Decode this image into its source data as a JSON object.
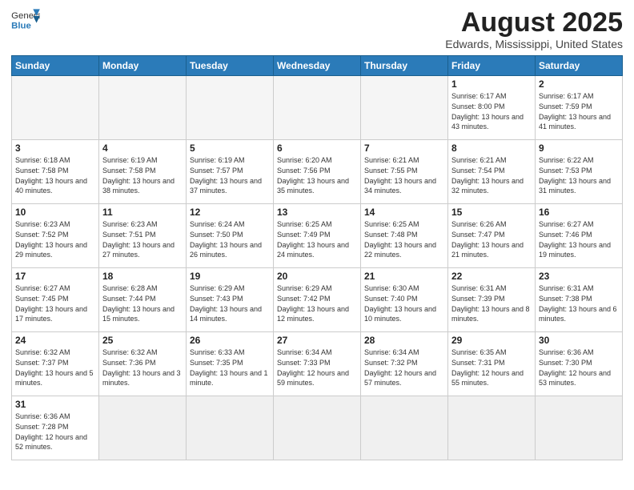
{
  "header": {
    "logo_text_normal": "General",
    "logo_text_blue": "Blue",
    "title": "August 2025",
    "subtitle": "Edwards, Mississippi, United States"
  },
  "weekdays": [
    "Sunday",
    "Monday",
    "Tuesday",
    "Wednesday",
    "Thursday",
    "Friday",
    "Saturday"
  ],
  "weeks": [
    [
      {
        "num": "",
        "info": ""
      },
      {
        "num": "",
        "info": ""
      },
      {
        "num": "",
        "info": ""
      },
      {
        "num": "",
        "info": ""
      },
      {
        "num": "",
        "info": ""
      },
      {
        "num": "1",
        "info": "Sunrise: 6:17 AM\nSunset: 8:00 PM\nDaylight: 13 hours and 43 minutes."
      },
      {
        "num": "2",
        "info": "Sunrise: 6:17 AM\nSunset: 7:59 PM\nDaylight: 13 hours and 41 minutes."
      }
    ],
    [
      {
        "num": "3",
        "info": "Sunrise: 6:18 AM\nSunset: 7:58 PM\nDaylight: 13 hours and 40 minutes."
      },
      {
        "num": "4",
        "info": "Sunrise: 6:19 AM\nSunset: 7:58 PM\nDaylight: 13 hours and 38 minutes."
      },
      {
        "num": "5",
        "info": "Sunrise: 6:19 AM\nSunset: 7:57 PM\nDaylight: 13 hours and 37 minutes."
      },
      {
        "num": "6",
        "info": "Sunrise: 6:20 AM\nSunset: 7:56 PM\nDaylight: 13 hours and 35 minutes."
      },
      {
        "num": "7",
        "info": "Sunrise: 6:21 AM\nSunset: 7:55 PM\nDaylight: 13 hours and 34 minutes."
      },
      {
        "num": "8",
        "info": "Sunrise: 6:21 AM\nSunset: 7:54 PM\nDaylight: 13 hours and 32 minutes."
      },
      {
        "num": "9",
        "info": "Sunrise: 6:22 AM\nSunset: 7:53 PM\nDaylight: 13 hours and 31 minutes."
      }
    ],
    [
      {
        "num": "10",
        "info": "Sunrise: 6:23 AM\nSunset: 7:52 PM\nDaylight: 13 hours and 29 minutes."
      },
      {
        "num": "11",
        "info": "Sunrise: 6:23 AM\nSunset: 7:51 PM\nDaylight: 13 hours and 27 minutes."
      },
      {
        "num": "12",
        "info": "Sunrise: 6:24 AM\nSunset: 7:50 PM\nDaylight: 13 hours and 26 minutes."
      },
      {
        "num": "13",
        "info": "Sunrise: 6:25 AM\nSunset: 7:49 PM\nDaylight: 13 hours and 24 minutes."
      },
      {
        "num": "14",
        "info": "Sunrise: 6:25 AM\nSunset: 7:48 PM\nDaylight: 13 hours and 22 minutes."
      },
      {
        "num": "15",
        "info": "Sunrise: 6:26 AM\nSunset: 7:47 PM\nDaylight: 13 hours and 21 minutes."
      },
      {
        "num": "16",
        "info": "Sunrise: 6:27 AM\nSunset: 7:46 PM\nDaylight: 13 hours and 19 minutes."
      }
    ],
    [
      {
        "num": "17",
        "info": "Sunrise: 6:27 AM\nSunset: 7:45 PM\nDaylight: 13 hours and 17 minutes."
      },
      {
        "num": "18",
        "info": "Sunrise: 6:28 AM\nSunset: 7:44 PM\nDaylight: 13 hours and 15 minutes."
      },
      {
        "num": "19",
        "info": "Sunrise: 6:29 AM\nSunset: 7:43 PM\nDaylight: 13 hours and 14 minutes."
      },
      {
        "num": "20",
        "info": "Sunrise: 6:29 AM\nSunset: 7:42 PM\nDaylight: 13 hours and 12 minutes."
      },
      {
        "num": "21",
        "info": "Sunrise: 6:30 AM\nSunset: 7:40 PM\nDaylight: 13 hours and 10 minutes."
      },
      {
        "num": "22",
        "info": "Sunrise: 6:31 AM\nSunset: 7:39 PM\nDaylight: 13 hours and 8 minutes."
      },
      {
        "num": "23",
        "info": "Sunrise: 6:31 AM\nSunset: 7:38 PM\nDaylight: 13 hours and 6 minutes."
      }
    ],
    [
      {
        "num": "24",
        "info": "Sunrise: 6:32 AM\nSunset: 7:37 PM\nDaylight: 13 hours and 5 minutes."
      },
      {
        "num": "25",
        "info": "Sunrise: 6:32 AM\nSunset: 7:36 PM\nDaylight: 13 hours and 3 minutes."
      },
      {
        "num": "26",
        "info": "Sunrise: 6:33 AM\nSunset: 7:35 PM\nDaylight: 13 hours and 1 minute."
      },
      {
        "num": "27",
        "info": "Sunrise: 6:34 AM\nSunset: 7:33 PM\nDaylight: 12 hours and 59 minutes."
      },
      {
        "num": "28",
        "info": "Sunrise: 6:34 AM\nSunset: 7:32 PM\nDaylight: 12 hours and 57 minutes."
      },
      {
        "num": "29",
        "info": "Sunrise: 6:35 AM\nSunset: 7:31 PM\nDaylight: 12 hours and 55 minutes."
      },
      {
        "num": "30",
        "info": "Sunrise: 6:36 AM\nSunset: 7:30 PM\nDaylight: 12 hours and 53 minutes."
      }
    ],
    [
      {
        "num": "31",
        "info": "Sunrise: 6:36 AM\nSunset: 7:28 PM\nDaylight: 12 hours and 52 minutes."
      },
      {
        "num": "",
        "info": ""
      },
      {
        "num": "",
        "info": ""
      },
      {
        "num": "",
        "info": ""
      },
      {
        "num": "",
        "info": ""
      },
      {
        "num": "",
        "info": ""
      },
      {
        "num": "",
        "info": ""
      }
    ]
  ]
}
